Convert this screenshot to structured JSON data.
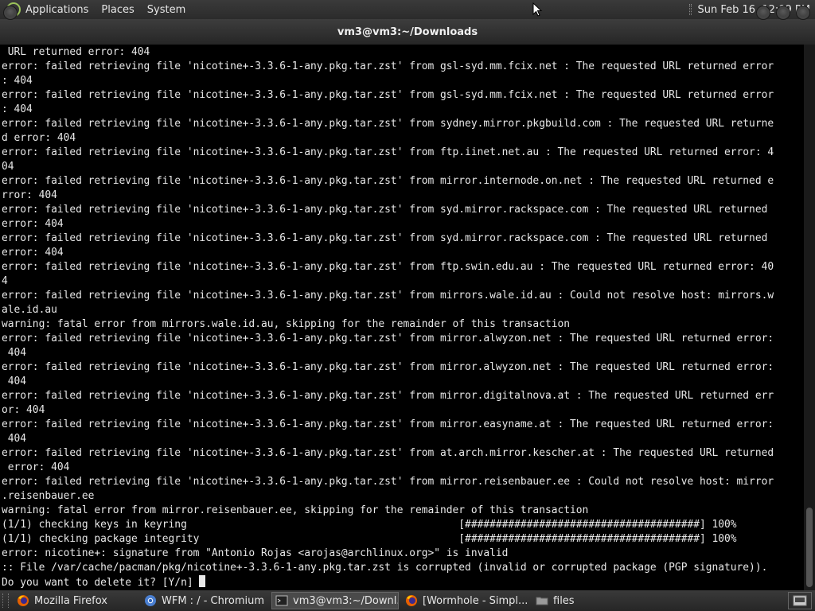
{
  "top_panel": {
    "menus": [
      "Applications",
      "Places",
      "System"
    ],
    "clock": "Sun Feb 16, 12:09 PM"
  },
  "window": {
    "title": "vm3@vm3:~/Downloads"
  },
  "terminal": {
    "lines": [
      " URL returned error: 404",
      "error: failed retrieving file 'nicotine+-3.3.6-1-any.pkg.tar.zst' from gsl-syd.mm.fcix.net : The requested URL returned error",
      ": 404",
      "error: failed retrieving file 'nicotine+-3.3.6-1-any.pkg.tar.zst' from gsl-syd.mm.fcix.net : The requested URL returned error",
      ": 404",
      "error: failed retrieving file 'nicotine+-3.3.6-1-any.pkg.tar.zst' from sydney.mirror.pkgbuild.com : The requested URL returne",
      "d error: 404",
      "error: failed retrieving file 'nicotine+-3.3.6-1-any.pkg.tar.zst' from ftp.iinet.net.au : The requested URL returned error: 4",
      "04",
      "error: failed retrieving file 'nicotine+-3.3.6-1-any.pkg.tar.zst' from mirror.internode.on.net : The requested URL returned e",
      "rror: 404",
      "error: failed retrieving file 'nicotine+-3.3.6-1-any.pkg.tar.zst' from syd.mirror.rackspace.com : The requested URL returned",
      "error: 404",
      "error: failed retrieving file 'nicotine+-3.3.6-1-any.pkg.tar.zst' from syd.mirror.rackspace.com : The requested URL returned",
      "error: 404",
      "error: failed retrieving file 'nicotine+-3.3.6-1-any.pkg.tar.zst' from ftp.swin.edu.au : The requested URL returned error: 40",
      "4",
      "error: failed retrieving file 'nicotine+-3.3.6-1-any.pkg.tar.zst' from mirrors.wale.id.au : Could not resolve host: mirrors.w",
      "ale.id.au",
      "warning: fatal error from mirrors.wale.id.au, skipping for the remainder of this transaction",
      "error: failed retrieving file 'nicotine+-3.3.6-1-any.pkg.tar.zst' from mirror.alwyzon.net : The requested URL returned error:",
      " 404",
      "error: failed retrieving file 'nicotine+-3.3.6-1-any.pkg.tar.zst' from mirror.alwyzon.net : The requested URL returned error:",
      " 404",
      "error: failed retrieving file 'nicotine+-3.3.6-1-any.pkg.tar.zst' from mirror.digitalnova.at : The requested URL returned err",
      "or: 404",
      "error: failed retrieving file 'nicotine+-3.3.6-1-any.pkg.tar.zst' from mirror.easyname.at : The requested URL returned error:",
      " 404",
      "error: failed retrieving file 'nicotine+-3.3.6-1-any.pkg.tar.zst' from at.arch.mirror.kescher.at : The requested URL returned",
      " error: 404",
      "error: failed retrieving file 'nicotine+-3.3.6-1-any.pkg.tar.zst' from mirror.reisenbauer.ee : Could not resolve host: mirror",
      ".reisenbauer.ee",
      "warning: fatal error from mirror.reisenbauer.ee, skipping for the remainder of this transaction",
      "(1/1) checking keys in keyring                                            [######################################] 100%",
      "(1/1) checking package integrity                                          [######################################] 100%",
      "error: nicotine+: signature from \"Antonio Rojas <arojas@archlinux.org>\" is invalid",
      ":: File /var/cache/pacman/pkg/nicotine+-3.3.6-1-any.pkg.tar.zst is corrupted (invalid or corrupted package (PGP signature)).",
      "Do you want to delete it? [Y/n] "
    ]
  },
  "taskbar": {
    "items": [
      {
        "label": "Mozilla Firefox",
        "icon": "firefox-icon"
      },
      {
        "label": "WFM : / - Chromium",
        "icon": "chromium-icon"
      },
      {
        "label": "vm3@vm3:~/Downl...",
        "icon": "terminal-icon"
      },
      {
        "label": "[Wormhole - Simpl...",
        "icon": "firefox-icon"
      },
      {
        "label": "files",
        "icon": "folder-icon"
      }
    ]
  },
  "colors": {
    "panel_bg": "#2b2b2b",
    "terminal_bg": "#000000",
    "terminal_fg": "#e8e8e8"
  }
}
